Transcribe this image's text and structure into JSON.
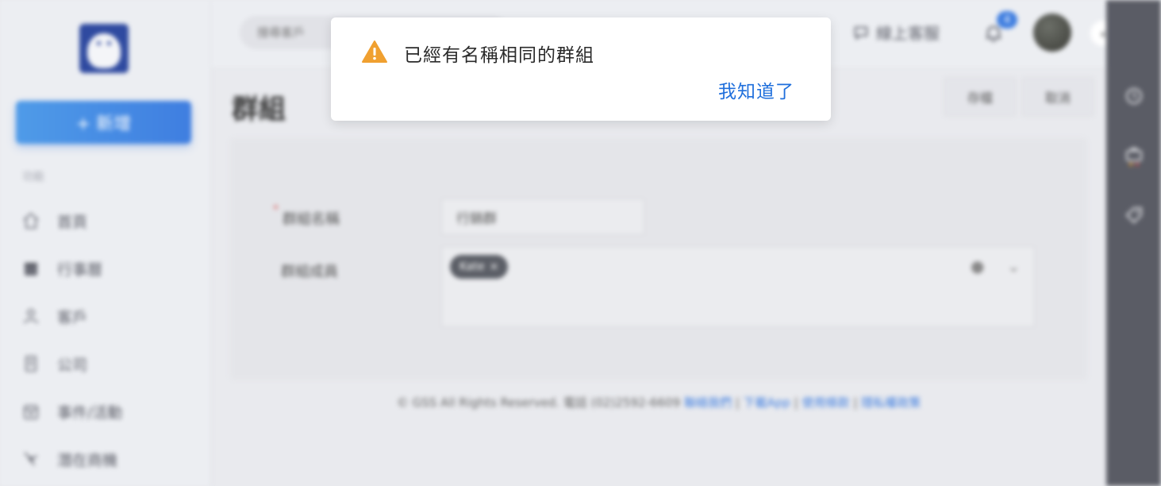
{
  "sidebar": {
    "new_button": "+ 新增",
    "section_label": "功能",
    "items": [
      {
        "label": "首頁",
        "icon": "home-icon"
      },
      {
        "label": "行事曆",
        "icon": "calendar-icon"
      },
      {
        "label": "客戶",
        "icon": "user-icon"
      },
      {
        "label": "公司",
        "icon": "building-icon"
      },
      {
        "label": "事件/活動",
        "icon": "event-icon"
      },
      {
        "label": "潛在商機",
        "icon": "opportunity-icon"
      }
    ]
  },
  "header": {
    "search_placeholder": "搜尋客戶",
    "support_label": "線上客服",
    "notification_count": "4"
  },
  "page": {
    "title": "群組",
    "save_label": "存檔",
    "cancel_label": "取消",
    "group_name_label": "群組名稱",
    "group_name_value": "行銷群",
    "members_label": "群組成員",
    "members": [
      "Kate"
    ]
  },
  "footer": {
    "copyright": "© GSS All Rights Reserved. 電話 (02)2592-6609",
    "links": [
      "聯絡我們",
      "下載App",
      "使用條款",
      "隱私權政策"
    ],
    "separator": "|"
  },
  "dialog": {
    "message": "已經有名稱相同的群組",
    "confirm_label": "我知道了",
    "warning_color": "#f0a030"
  },
  "colors": {
    "accent": "#3f7ee0",
    "link": "#1f6fdc"
  }
}
